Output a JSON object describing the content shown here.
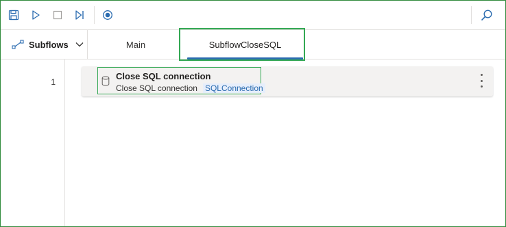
{
  "toolbar": {
    "buttons": [
      {
        "name": "save-icon"
      },
      {
        "name": "run-icon"
      },
      {
        "name": "stop-icon"
      },
      {
        "name": "run-next-action-icon"
      },
      {
        "name": "record-icon"
      }
    ],
    "search_icon": "search-icon",
    "accent_color": "#2b6cb0"
  },
  "subflows": {
    "label": "Subflows"
  },
  "tabs": [
    {
      "label": "Main",
      "selected": false
    },
    {
      "label": "SubflowCloseSQL",
      "selected": true
    }
  ],
  "actions": [
    {
      "line": "1",
      "title": "Close SQL connection",
      "description": "Close SQL connection",
      "variable": "SQLConnection",
      "icon": "database-icon"
    }
  ],
  "highlight_color": "#33a853"
}
